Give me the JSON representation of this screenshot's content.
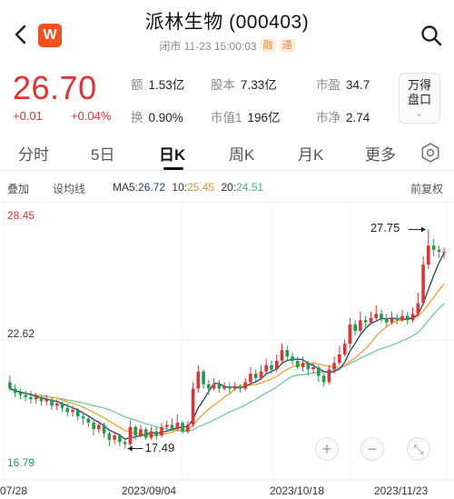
{
  "header": {
    "app_logo": "W",
    "title": "派林生物 (000403)",
    "status": "闭市 11-23 15:00:03",
    "tags": [
      "融",
      "通"
    ]
  },
  "quote": {
    "price": "26.70",
    "change": "+0.01",
    "change_pct": "+0.04%",
    "stats": [
      {
        "label": "额",
        "value": "1.53亿"
      },
      {
        "label": "股本",
        "value": "7.33亿"
      },
      {
        "label": "市盈",
        "value": "34.7"
      },
      {
        "label": "换",
        "value": "0.90%"
      },
      {
        "label": "市值1",
        "value": "196亿"
      },
      {
        "label": "市净",
        "value": "2.74"
      }
    ],
    "depth_button": [
      "万得",
      "盘口"
    ]
  },
  "tabs": [
    "分时",
    "5日",
    "日K",
    "周K",
    "月K",
    "更多"
  ],
  "active_tab": "日K",
  "toolbar": {
    "overlay": "叠加",
    "set_line": "设均线",
    "ma5_label": "MA5:",
    "ma5_value": "26.72",
    "ma10_label": "10:",
    "ma10_value": "25.45",
    "ma20_label": "20:",
    "ma20_value": "24.51",
    "adjust": "前复权"
  },
  "colors": {
    "up": "#e93030",
    "down": "#1f9e48",
    "ma5": "#1f3f7a",
    "ma10": "#f0a030",
    "ma20": "#6ccaa0"
  },
  "chart_data": {
    "type": "candlestick",
    "y_labels": [
      "28.45",
      "22.62",
      "16.79"
    ],
    "ylim": [
      16.79,
      28.45
    ],
    "x_labels": [
      "07/28",
      "2023/09/04",
      "2023/10/18",
      "2023/11/23"
    ],
    "annotations": [
      {
        "text": "27.75",
        "kind": "high"
      },
      {
        "text": "17.49",
        "kind": "low"
      }
    ],
    "candles": [
      [
        20.6,
        20.3,
        20.9,
        20.2
      ],
      [
        20.3,
        20.1,
        20.5,
        19.9
      ],
      [
        20.1,
        20.0,
        20.3,
        19.8
      ],
      [
        20.0,
        19.9,
        20.2,
        19.7
      ],
      [
        19.9,
        19.8,
        20.2,
        19.6
      ],
      [
        19.8,
        19.9,
        20.1,
        19.6
      ],
      [
        19.9,
        19.7,
        20.0,
        19.5
      ],
      [
        19.7,
        19.8,
        20.0,
        19.5
      ],
      [
        19.8,
        19.5,
        19.9,
        19.3
      ],
      [
        19.5,
        19.6,
        19.8,
        19.3
      ],
      [
        19.6,
        19.4,
        19.7,
        19.2
      ],
      [
        19.4,
        19.2,
        19.6,
        19.0
      ],
      [
        19.2,
        19.3,
        19.5,
        19.0
      ],
      [
        19.3,
        19.0,
        19.4,
        18.8
      ],
      [
        19.0,
        18.9,
        19.2,
        18.6
      ],
      [
        18.9,
        18.7,
        19.0,
        18.5
      ],
      [
        18.7,
        18.4,
        18.8,
        18.1
      ],
      [
        18.4,
        18.6,
        18.8,
        18.2
      ],
      [
        18.6,
        18.2,
        18.7,
        18.0
      ],
      [
        18.2,
        17.9,
        18.3,
        17.6
      ],
      [
        17.9,
        18.1,
        18.3,
        17.7
      ],
      [
        18.1,
        17.8,
        18.2,
        17.6
      ],
      [
        17.8,
        17.7,
        17.9,
        17.49
      ],
      [
        17.7,
        18.5,
        18.8,
        17.6
      ],
      [
        18.5,
        18.1,
        18.6,
        17.9
      ],
      [
        18.1,
        18.4,
        18.6,
        18.0
      ],
      [
        18.4,
        18.0,
        18.5,
        17.9
      ],
      [
        18.0,
        18.3,
        18.5,
        17.9
      ],
      [
        18.3,
        18.1,
        18.5,
        17.9
      ],
      [
        18.1,
        18.5,
        18.7,
        18.0
      ],
      [
        18.5,
        18.6,
        18.8,
        18.3
      ],
      [
        18.6,
        18.4,
        18.9,
        18.3
      ],
      [
        18.4,
        18.7,
        19.1,
        18.3
      ],
      [
        18.7,
        18.3,
        18.8,
        18.2
      ],
      [
        18.3,
        18.6,
        18.8,
        18.2
      ],
      [
        18.6,
        20.3,
        20.6,
        18.5
      ],
      [
        20.3,
        21.1,
        21.4,
        20.1
      ],
      [
        21.1,
        20.5,
        21.2,
        20.3
      ],
      [
        20.5,
        20.3,
        20.7,
        20.0
      ],
      [
        20.3,
        20.5,
        20.8,
        20.2
      ],
      [
        20.5,
        20.3,
        20.7,
        20.1
      ],
      [
        20.3,
        20.4,
        20.6,
        20.2
      ],
      [
        20.4,
        20.3,
        20.6,
        20.1
      ],
      [
        20.3,
        20.4,
        20.6,
        20.2
      ],
      [
        20.4,
        20.3,
        20.5,
        20.1
      ],
      [
        20.3,
        20.6,
        20.8,
        20.2
      ],
      [
        20.6,
        21.0,
        21.3,
        20.5
      ],
      [
        21.0,
        20.8,
        21.2,
        20.6
      ],
      [
        20.8,
        21.1,
        21.4,
        20.7
      ],
      [
        21.1,
        21.4,
        21.7,
        21.0
      ],
      [
        21.4,
        21.2,
        21.6,
        21.0
      ],
      [
        21.2,
        21.6,
        21.9,
        21.1
      ],
      [
        21.6,
        22.1,
        22.4,
        21.5
      ],
      [
        22.1,
        21.8,
        22.3,
        21.6
      ],
      [
        21.8,
        21.6,
        22.0,
        21.4
      ],
      [
        21.6,
        21.3,
        21.8,
        21.2
      ],
      [
        21.3,
        21.5,
        21.8,
        21.1
      ],
      [
        21.5,
        21.2,
        21.6,
        20.9
      ],
      [
        21.2,
        21.3,
        21.5,
        21.0
      ],
      [
        21.3,
        20.9,
        21.4,
        20.6
      ],
      [
        20.9,
        20.6,
        21.0,
        20.4
      ],
      [
        20.6,
        21.2,
        21.4,
        20.5
      ],
      [
        21.2,
        21.5,
        21.8,
        21.0
      ],
      [
        21.5,
        21.9,
        22.3,
        21.4
      ],
      [
        21.9,
        22.4,
        22.6,
        21.8
      ],
      [
        22.4,
        23.3,
        23.6,
        22.2
      ],
      [
        23.3,
        23.0,
        23.5,
        22.8
      ],
      [
        23.0,
        23.5,
        23.9,
        22.9
      ],
      [
        23.5,
        23.4,
        23.7,
        23.1
      ],
      [
        23.4,
        23.6,
        23.9,
        23.3
      ],
      [
        23.6,
        23.8,
        24.2,
        23.5
      ],
      [
        23.8,
        23.6,
        24.0,
        23.4
      ],
      [
        23.6,
        23.4,
        23.8,
        23.2
      ],
      [
        23.4,
        23.6,
        23.9,
        23.3
      ],
      [
        23.6,
        23.5,
        23.8,
        23.3
      ],
      [
        23.5,
        23.7,
        24.0,
        23.4
      ],
      [
        23.7,
        23.5,
        23.9,
        23.3
      ],
      [
        23.5,
        23.8,
        24.1,
        23.4
      ],
      [
        23.8,
        24.3,
        24.8,
        23.7
      ],
      [
        24.3,
        26.1,
        26.5,
        24.2
      ],
      [
        26.1,
        27.0,
        27.75,
        25.9
      ],
      [
        27.0,
        26.8,
        27.3,
        26.5
      ],
      [
        26.8,
        26.7,
        27.0,
        26.4
      ],
      [
        26.7,
        26.7,
        26.9,
        26.4
      ]
    ]
  }
}
